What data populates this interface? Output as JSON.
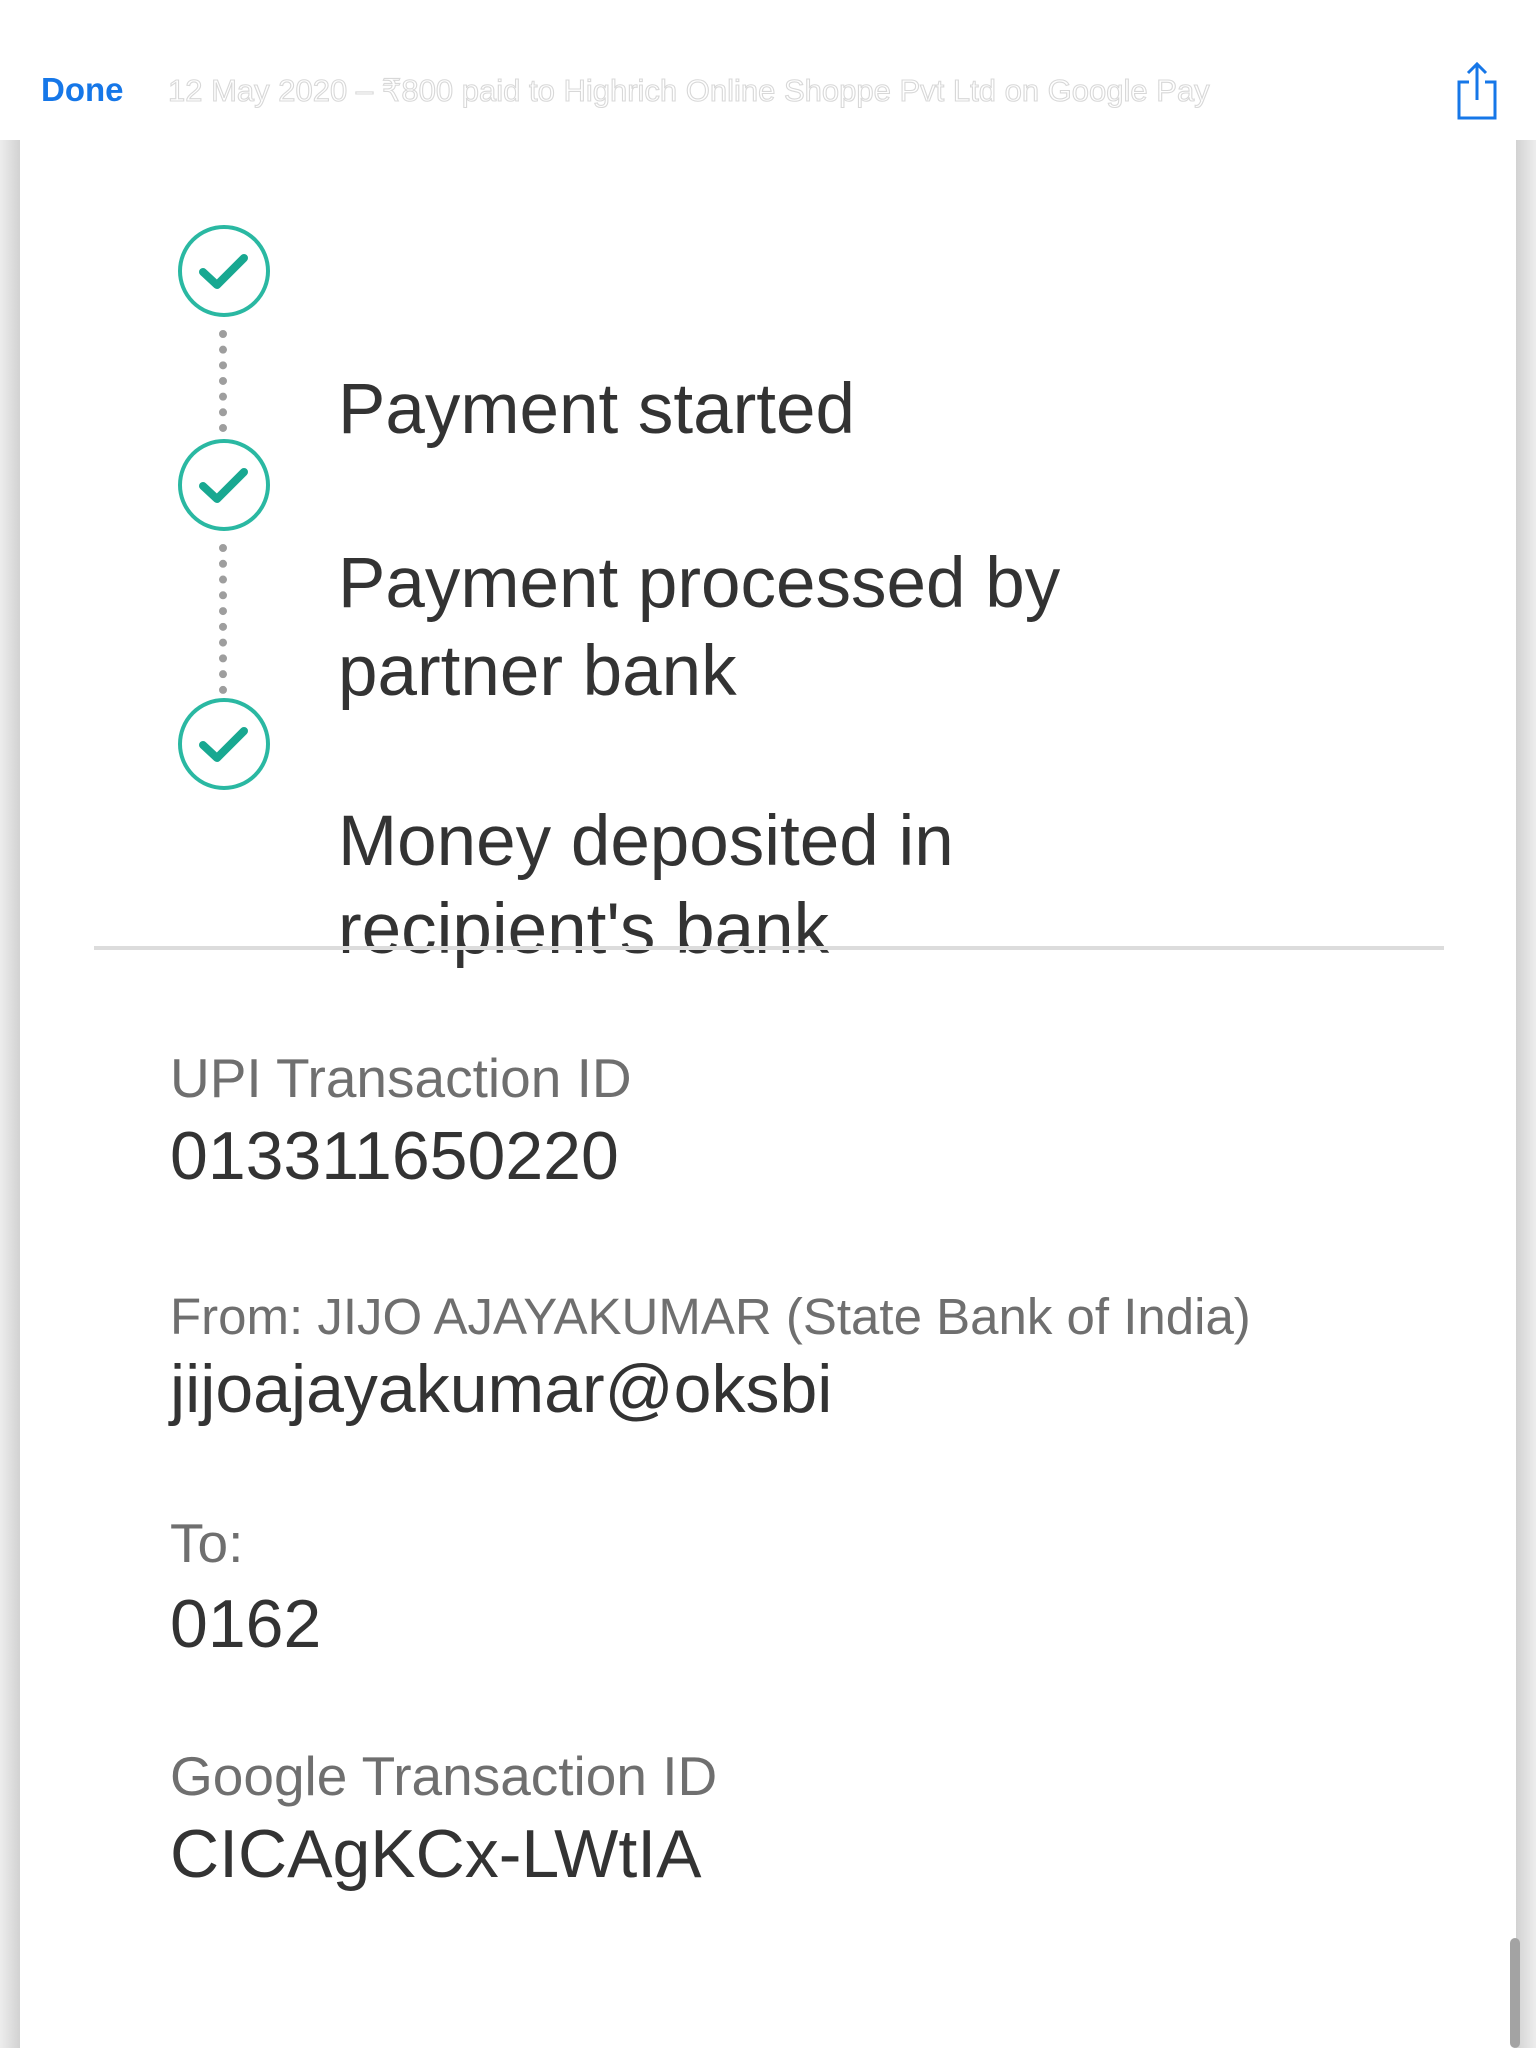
{
  "navbar": {
    "done_label": "Done",
    "title": "12 May 2020 – ₹800 paid to Highrich Online Shoppe Pvt Ltd on Google Pay",
    "share_icon": "share-icon"
  },
  "timeline": {
    "check_color": "#2ab8a2",
    "steps": [
      {
        "lines": [
          "Payment started"
        ]
      },
      {
        "lines": [
          "Payment processed by",
          "partner bank"
        ]
      },
      {
        "lines": [
          "Money deposited in",
          "recipient's bank"
        ]
      }
    ]
  },
  "details": {
    "upi": {
      "label": "UPI Transaction ID",
      "value": "013311650220"
    },
    "from": {
      "label": "From: JIJO  AJAYAKUMAR (State Bank of India)",
      "value": "jijoajayakumar@oksbi"
    },
    "to": {
      "label": "To:",
      "value": "0162"
    },
    "google": {
      "label": "Google Transaction ID",
      "value": "CICAgKCx-LWtIA"
    }
  },
  "colors": {
    "accent": "#1677e8",
    "text_primary": "#333333",
    "text_secondary": "#6f6f6f"
  }
}
